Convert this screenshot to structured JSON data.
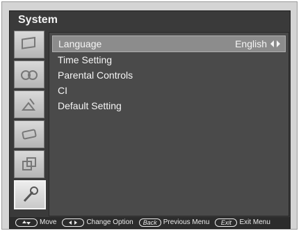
{
  "window": {
    "title": "System"
  },
  "sidebar": {
    "items": [
      {
        "icon": "picture-icon"
      },
      {
        "icon": "audio-icon"
      },
      {
        "icon": "channel-icon"
      },
      {
        "icon": "source-icon"
      },
      {
        "icon": "screen-icon"
      },
      {
        "icon": "system-icon",
        "active": true
      }
    ]
  },
  "menu": {
    "items": [
      {
        "label": "Language",
        "value": "English"
      },
      {
        "label": "Time Setting"
      },
      {
        "label": "Parental Controls"
      },
      {
        "label": "CI"
      },
      {
        "label": "Default Setting"
      }
    ]
  },
  "footer": {
    "move_label": "Move",
    "change_label": "Change Option",
    "back_key": "Back",
    "back_label": "Previous Menu",
    "exit_key": "Exit",
    "exit_label": "Exit Menu"
  },
  "colors": {
    "background": "#3a3a3a",
    "selected_row": "#8c8c8c",
    "text": "#f5f5f5"
  }
}
